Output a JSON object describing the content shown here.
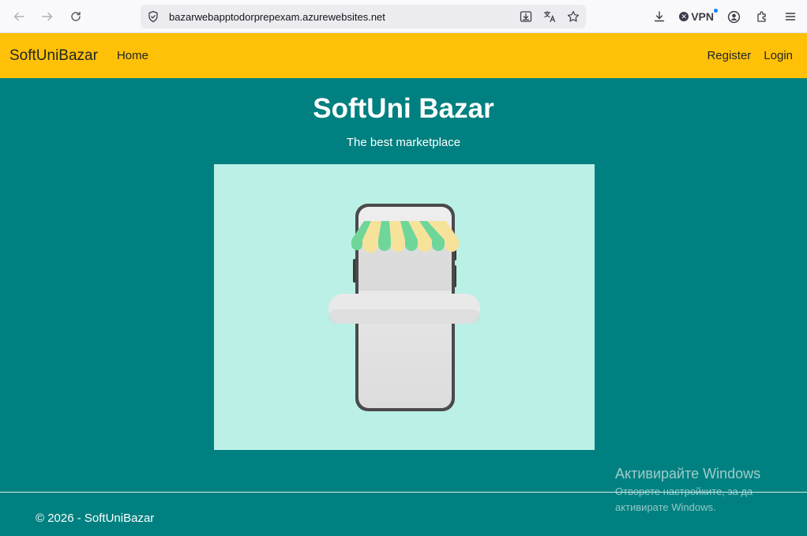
{
  "browser": {
    "url": "bazarwebapptodorprepexam.azurewebsites.net",
    "vpn_label": "VPN"
  },
  "navbar": {
    "brand": "SoftUniBazar",
    "home": "Home",
    "register": "Register",
    "login": "Login",
    "color": "#ffc107"
  },
  "hero": {
    "title": "SoftUni Bazar",
    "subtitle": "The best marketplace",
    "background": "#008080"
  },
  "footer": {
    "text": "© 2026 - SoftUniBazar"
  },
  "watermark": {
    "title": "Активирайте Windows",
    "line1": "Отворете настройките, за да",
    "line2": "активирате Windows."
  }
}
